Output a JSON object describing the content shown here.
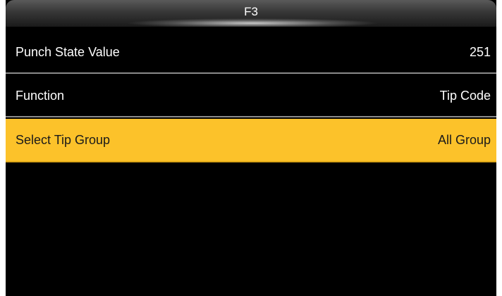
{
  "header": {
    "title": "F3"
  },
  "menu": {
    "items": [
      {
        "label": "Punch State Value",
        "value": "251",
        "selected": false
      },
      {
        "label": "Function",
        "value": "Tip Code",
        "selected": false
      },
      {
        "label": "Select Tip Group",
        "value": "All Group",
        "selected": true
      }
    ]
  },
  "colors": {
    "background": "#000000",
    "selected_row": "#fcc22a",
    "divider": "#8a8a8a",
    "text": "#ffffff"
  }
}
